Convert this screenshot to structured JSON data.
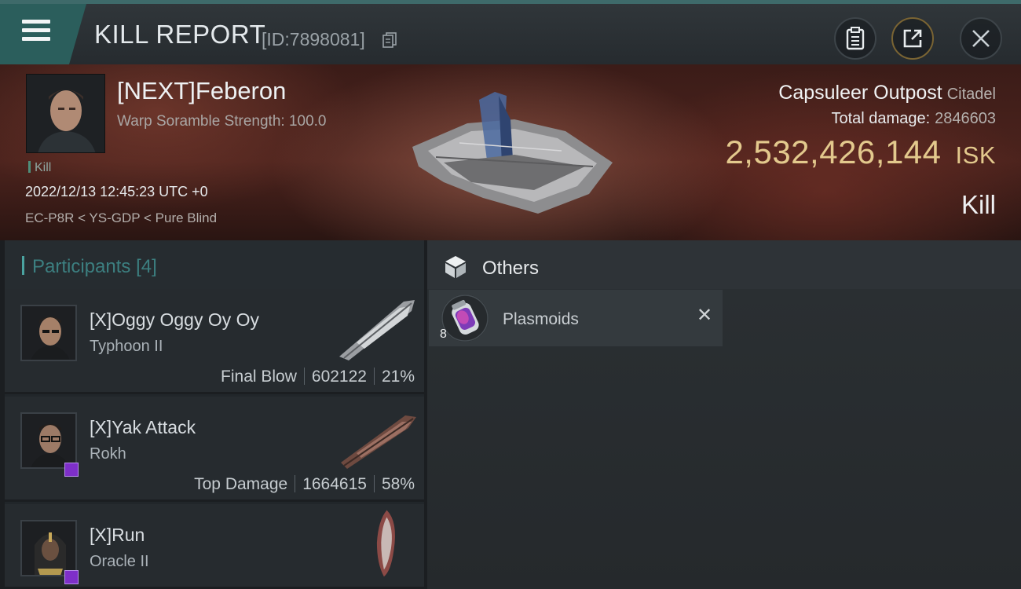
{
  "header": {
    "title": "KILL REPORT",
    "report_id": "[ID:7898081]",
    "icons": [
      "menu-icon",
      "copy-icon",
      "clipboard-icon",
      "share-icon",
      "close-icon"
    ]
  },
  "victim": {
    "name": "[NEXT]Feberon",
    "detail": "Warp Soramble Strength: 100.0",
    "tag": "Kill",
    "datetime": "2022/12/13 12:45:23 UTC +0",
    "location": "EC-P8R < YS-GDP < Pure Blind",
    "target_name": "Capsuleer Outpost",
    "target_type": "Citadel",
    "total_damage_label": "Total damage:",
    "total_damage_value": "2846603",
    "isk_value": "2,532,426,144",
    "isk_unit": "ISK",
    "result": "Kill"
  },
  "participants": {
    "title": "Participants",
    "count": "[4]",
    "rows": [
      {
        "name": "[X]Oggy Oggy Oy Oy",
        "ship": "Typhoon II",
        "role": "Final Blow",
        "damage": "602122",
        "percent": "21%"
      },
      {
        "name": "[X]Yak Attack",
        "ship": "Rokh",
        "role": "Top Damage",
        "damage": "1664615",
        "percent": "58%"
      },
      {
        "name": "[X]Run",
        "ship": "Oracle II",
        "role": "",
        "damage": "",
        "percent": ""
      }
    ]
  },
  "others": {
    "title": "Others",
    "items": [
      {
        "label": "Plasmoids",
        "quantity": "8"
      }
    ]
  },
  "colors": {
    "accent_teal": "#3c7f80",
    "isk_gold": "#e3c98d",
    "badge_purple": "#7e2fc9"
  }
}
